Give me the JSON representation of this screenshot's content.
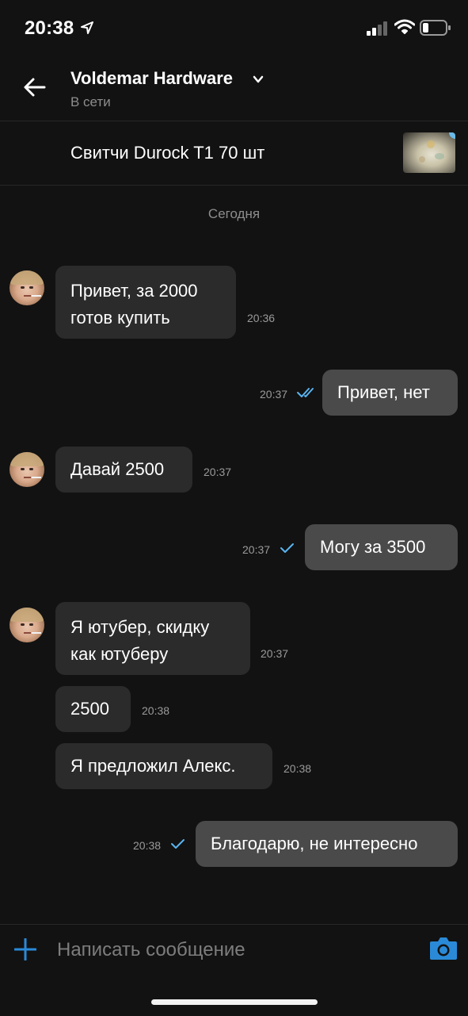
{
  "status_bar": {
    "time": "20:38"
  },
  "header": {
    "contact_name": "Voldemar Hardware",
    "contact_status": "В сети"
  },
  "listing": {
    "title": "Свитчи Durock T1 70 шт"
  },
  "date_separator": "Сегодня",
  "messages": [
    {
      "direction": "in",
      "lines": [
        "Привет, за 2000",
        "готов купить"
      ],
      "time": "20:36"
    },
    {
      "direction": "out",
      "lines": [
        "Привет, нет"
      ],
      "time": "20:37",
      "status": "read"
    },
    {
      "direction": "in",
      "lines": [
        "Давай 2500"
      ],
      "time": "20:37"
    },
    {
      "direction": "out",
      "lines": [
        "Могу за 3500"
      ],
      "time": "20:37",
      "status": "delivered"
    },
    {
      "direction": "in",
      "lines": [
        "Я ютубер, скидку",
        "как ютуберу"
      ],
      "time": "20:37"
    },
    {
      "direction": "in",
      "lines": [
        "2500"
      ],
      "time": "20:38"
    },
    {
      "direction": "in",
      "lines": [
        "Я предложил Алекс."
      ],
      "time": "20:38"
    },
    {
      "direction": "out",
      "lines": [
        "Благодарю, не интересно"
      ],
      "time": "20:38",
      "status": "delivered"
    }
  ],
  "composer": {
    "placeholder": "Написать сообщение"
  },
  "colors": {
    "accent": "#2a8ad8",
    "tick": "#5ab4f0",
    "bubble_in": "#2b2b2b",
    "bubble_out": "#4a4a4a"
  }
}
